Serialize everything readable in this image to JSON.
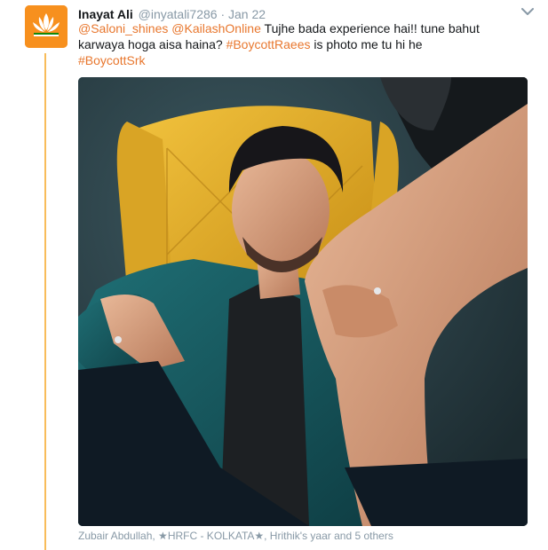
{
  "tweet": {
    "author_name": "Inayat Ali",
    "author_handle": "@inyatali7286",
    "separator": "·",
    "timestamp": "Jan 22",
    "avatar_label": "BJP",
    "mention_1": "@Saloni_shines",
    "mention_2": "@KailashOnline",
    "text_part_1": "Tujhe bada experience hai!! tune bahut karwaya hoga aisa haina?",
    "hashtag_1": "#BoycottRaees",
    "text_part_2": "is photo me tu hi he",
    "hashtag_2": "#BoycottSrk",
    "tagged_people": "Zubair Abdullah, ★HRFC - KOLKATA★, Hrithik's yaar and 5 others"
  },
  "icons": {
    "menu": "chevron-down-icon",
    "avatar": "lotus-logo-icon"
  },
  "colors": {
    "link": "#e8772e",
    "thread_line": "#f5a623",
    "muted": "#8899a6",
    "avatar_bg": "#f7901e"
  }
}
